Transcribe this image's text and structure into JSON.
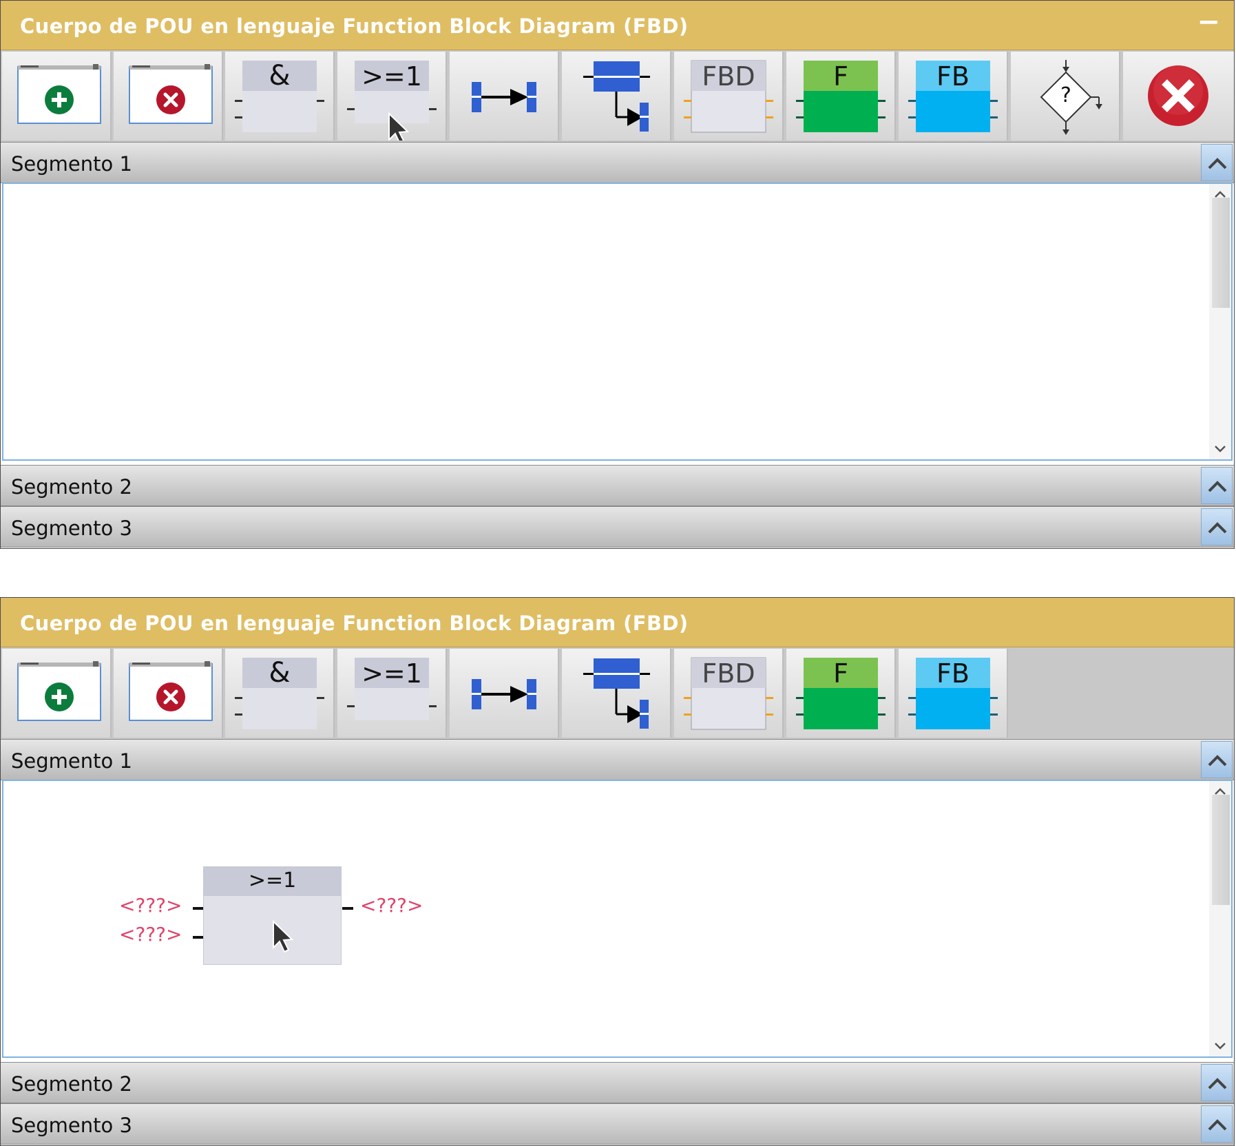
{
  "panels": [
    {
      "title": "Cuerpo de POU en lenguaje Function Block Diagram (FBD)",
      "minimize_label": "−",
      "segments": [
        "Segmento 1",
        "Segmento 2",
        "Segmento 3"
      ]
    },
    {
      "title": "Cuerpo de POU en lenguaje Function Block Diagram (FBD)",
      "segments": [
        "Segmento 1",
        "Segmento 2",
        "Segmento 3"
      ],
      "placed_block": {
        "operator": ">=1",
        "input_1": "<???>",
        "input_2": "<???>",
        "output": "<???>"
      }
    }
  ],
  "toolbar": {
    "and_label": "&",
    "or_label": ">=1",
    "fbd_label": "FBD",
    "function_label": "F",
    "function_block_label": "FB",
    "condition_label": "?"
  },
  "colors": {
    "title_bar": "#dfbd63",
    "add_green": "#0c7c3c",
    "remove_red": "#b5162b",
    "connector_blue": "#2f5fd0",
    "function_green": "#00b050",
    "function_block_cyan": "#00b0f0",
    "unknown_operand": "#e0436a"
  }
}
